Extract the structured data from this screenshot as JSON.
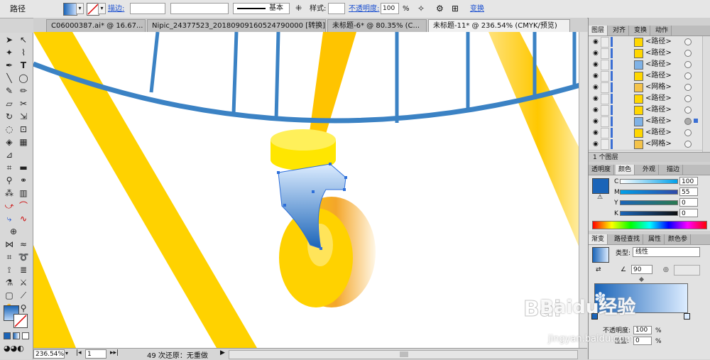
{
  "control_bar": {
    "selection_label": "路径",
    "stroke_label": "描边:",
    "stroke_profile": "基本",
    "style_label": "样式:",
    "opacity_label": "不透明度:",
    "opacity_value": "100",
    "opacity_unit": "%",
    "transform_label": "变换"
  },
  "doc_tabs": [
    "C06000387.ai* @ 16.67...",
    "Nipic_24377523_20180909160524790000 [转换].ai*",
    "未标题-6* @ 80.35% (C...",
    "未标题-11* @ 236.54% (CMYK/预览)"
  ],
  "status_bar": {
    "zoom": "236.54%",
    "artboard": "1",
    "undo_info": "49 次还原：无重做"
  },
  "layers_panel": {
    "tabs": [
      "图层",
      "对齐",
      "变换",
      "动作"
    ],
    "rows": [
      "<路径>",
      "<路径>",
      "<路径>",
      "<路径>",
      "<网格>",
      "<路径>",
      "<路径>",
      "<路径>",
      "<路径>",
      "<网格>"
    ],
    "footer_count": "1 个图层"
  },
  "color_panel": {
    "tabs": [
      "透明度",
      "颜色",
      "外观",
      "描边"
    ],
    "channels": [
      {
        "label": "C",
        "value": "100",
        "fraction": 1.0
      },
      {
        "label": "M",
        "value": "55",
        "fraction": 0.55
      },
      {
        "label": "Y",
        "value": "0",
        "fraction": 0
      },
      {
        "label": "K",
        "value": "0",
        "fraction": 0
      }
    ]
  },
  "gradient_panel": {
    "tabs": [
      "渐变",
      "路径查找",
      "属性",
      "颜色参"
    ],
    "type_label": "类型:",
    "type_value": "线性",
    "angle": "90",
    "opacity_label": "不透明度:",
    "opacity_value": "100",
    "location_label": "位置:",
    "location_value": "0",
    "pct": "%"
  },
  "watermark": {
    "logo": "Baidu经验",
    "url": "jingyan.baidu.com"
  },
  "colors": {
    "yellow": "#ffd200",
    "blue": "#3b82c4",
    "gradient_start": "#1a64b8",
    "gradient_end": "#dcecff"
  }
}
